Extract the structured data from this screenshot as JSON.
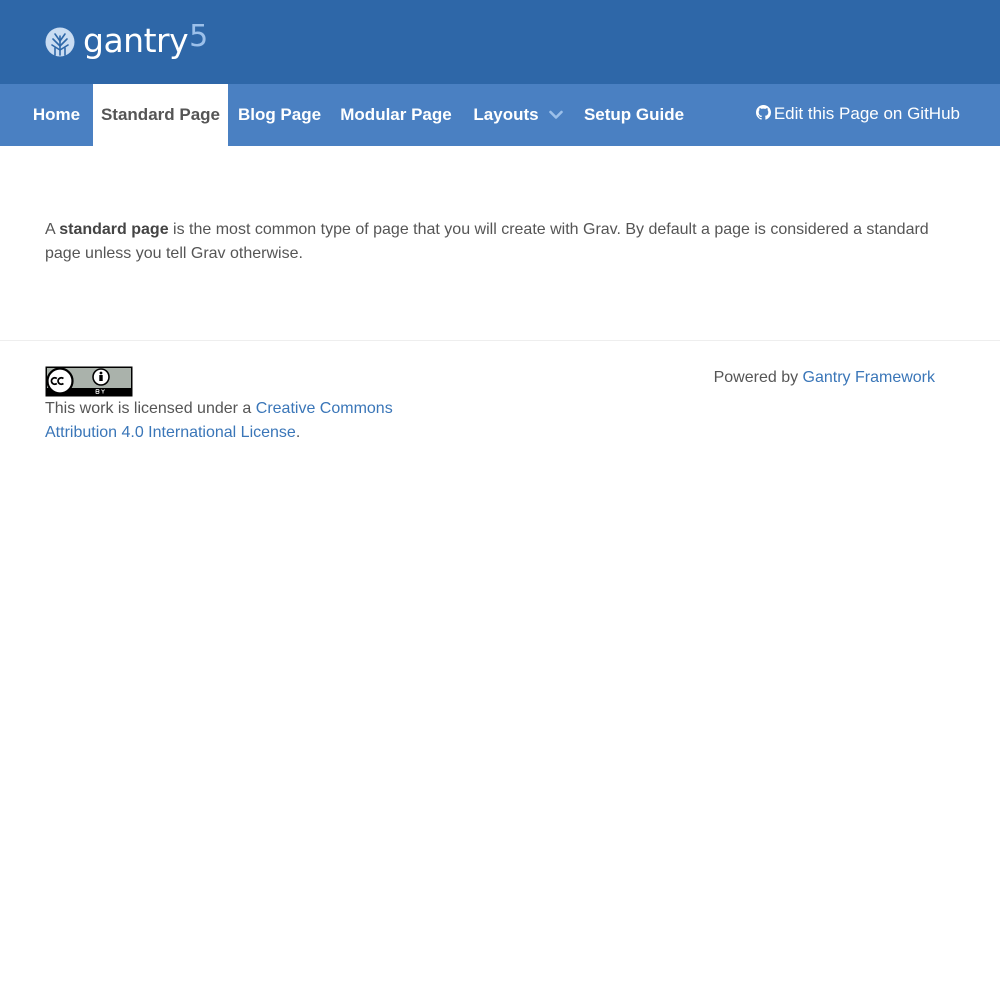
{
  "header": {
    "logo_text": "gantry",
    "logo_number": "5",
    "logo_icon": "gantry-globe-icon"
  },
  "nav": {
    "items": [
      {
        "label": "Home",
        "active": false
      },
      {
        "label": "Standard Page",
        "active": true
      },
      {
        "label": "Blog Page",
        "active": false
      },
      {
        "label": "Modular Page",
        "active": false
      },
      {
        "label": "Layouts",
        "active": false,
        "has_dropdown": true
      },
      {
        "label": "Setup Guide",
        "active": false
      }
    ],
    "github_label": "Edit this Page on GitHub",
    "github_icon": "github-icon"
  },
  "content": {
    "intro_prefix": "A ",
    "intro_bold": "standard page",
    "intro_rest": " is the most common type of page that you will create with Grav. By default a page is considered a standard page unless you tell Grav otherwise."
  },
  "footer": {
    "license_icon": "cc-by-badge-icon",
    "license_prefix": "This work is licensed under a ",
    "license_link": "Creative Commons Attribution 4.0 International License",
    "license_suffix": ".",
    "powered_prefix": "Powered by ",
    "powered_link": "Gantry Framework"
  },
  "colors": {
    "header_bg": "#2e67a8",
    "nav_bg": "#4a80c2",
    "link": "#3a76b8",
    "text": "#555555"
  }
}
